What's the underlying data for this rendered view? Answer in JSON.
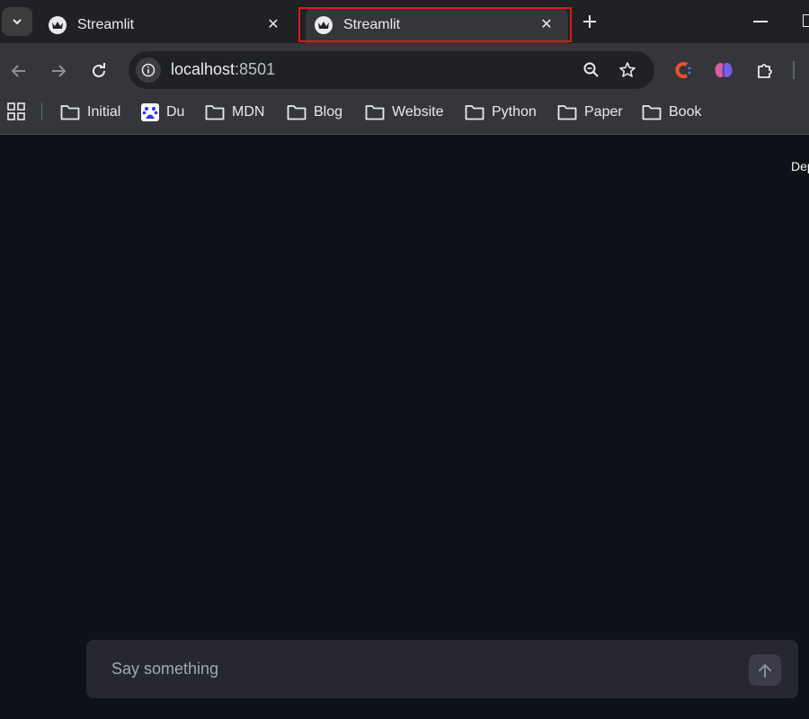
{
  "browser": {
    "tabs": [
      {
        "title": "Streamlit",
        "active": false
      },
      {
        "title": "Streamlit",
        "active": true
      }
    ],
    "address": {
      "host": "localhost",
      "port_suffix": ":8501"
    },
    "bookmarks": [
      {
        "label": "Initial",
        "icon": "folder-icon"
      },
      {
        "label": "Du",
        "icon": "baidu-icon"
      },
      {
        "label": "MDN",
        "icon": "folder-icon"
      },
      {
        "label": "Blog",
        "icon": "folder-icon"
      },
      {
        "label": "Website",
        "icon": "folder-icon"
      },
      {
        "label": "Python",
        "icon": "folder-icon"
      },
      {
        "label": "Paper",
        "icon": "folder-icon"
      },
      {
        "label": "Book",
        "icon": "folder-icon"
      }
    ],
    "highlight_color": "#e0161e"
  },
  "app": {
    "deploy_label": "Dep",
    "chat": {
      "placeholder": "Say something"
    },
    "colors": {
      "background": "#0e1117",
      "input_background": "#262730"
    }
  }
}
